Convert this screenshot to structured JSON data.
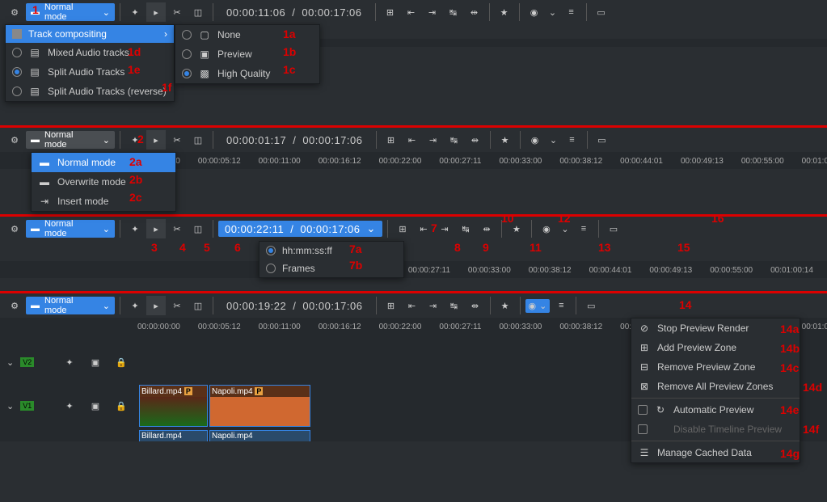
{
  "mode_button_label": "Normal mode",
  "timecodes": {
    "s1_cur": "00:00:11:06",
    "s1_dur": "00:00:17:06",
    "s2_cur": "00:00:01:17",
    "s2_dur": "00:00:17:06",
    "s3_cur": "00:00:22:11",
    "s3_dur": "00:00:17:06",
    "s4_cur": "00:00:19:22",
    "s4_dur": "00:00:17:06"
  },
  "ruler_times": [
    "00:00:00:00",
    "00:00:05:12",
    "00:00:11:00",
    "00:00:16:12",
    "00:00:22:00",
    "00:00:27:11",
    "00:00:33:00",
    "00:00:38:12",
    "00:00:44:01",
    "00:00:49:13",
    "00:00:55:00",
    "00:01:00:14"
  ],
  "track_compositing_menu": {
    "header": "Track compositing",
    "items": [
      {
        "label": "Mixed Audio tracks",
        "annot": "1d"
      },
      {
        "label": "Split Audio Tracks",
        "annot": "1e",
        "selected": true
      },
      {
        "label": "Split Audio Tracks (reverse)",
        "annot": "1f"
      }
    ],
    "submenu": [
      {
        "label": "None",
        "annot": "1a"
      },
      {
        "label": "Preview",
        "annot": "1b"
      },
      {
        "label": "High Quality",
        "annot": "1c",
        "selected": true
      }
    ]
  },
  "mode_menu": {
    "items": [
      {
        "label": "Normal mode",
        "annot": "2a",
        "hl": true
      },
      {
        "label": "Overwrite mode",
        "annot": "2b"
      },
      {
        "label": "Insert mode",
        "annot": "2c"
      }
    ]
  },
  "timecode_menu": {
    "items": [
      {
        "label": "hh:mm:ss:ff",
        "annot": "7a",
        "selected": true
      },
      {
        "label": "Frames",
        "annot": "7b"
      }
    ]
  },
  "preview_menu": {
    "items": [
      {
        "label": "Stop Preview Render",
        "annot": "14a",
        "icon": "⊘"
      },
      {
        "label": "Add Preview Zone",
        "annot": "14b",
        "icon": "⊞"
      },
      {
        "label": "Remove Preview Zone",
        "annot": "14c",
        "icon": "⊟"
      },
      {
        "label": "Remove All Preview Zones",
        "annot": "14d",
        "icon": "⊠"
      },
      {
        "label": "Automatic Preview",
        "annot": "14e",
        "checkbox": true
      },
      {
        "label": "Disable Timeline Preview",
        "annot": "14f",
        "checkbox": true,
        "disabled": true
      },
      {
        "label": "Manage Cached Data",
        "annot": "14g",
        "icon": "☰"
      }
    ]
  },
  "section3_annots": [
    "3",
    "4",
    "5",
    "6",
    "7",
    "8",
    "9",
    "10",
    "11",
    "12",
    "13",
    "15",
    "16"
  ],
  "clips": {
    "billard": "Billard.mp4",
    "napoli": "Napoli.mp4"
  },
  "tracks": {
    "v1": "V1",
    "v2": "V2"
  },
  "section2_annot": "2",
  "section4_annot": "14",
  "section1_annot": "1"
}
